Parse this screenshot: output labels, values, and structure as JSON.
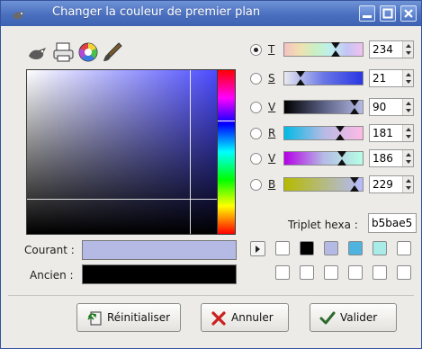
{
  "window": {
    "title": "Changer la couleur de premier plan"
  },
  "titlebar_buttons": {
    "minimize": "minimize-icon",
    "maximize": "maximize-icon",
    "close": "close-icon"
  },
  "tools": [
    {
      "name": "gimp-selector-icon"
    },
    {
      "name": "cmyk-printer-icon"
    },
    {
      "name": "color-wheel-icon"
    },
    {
      "name": "watercolor-brush-icon"
    }
  ],
  "channels": [
    {
      "letter": "T",
      "value": "234",
      "checked": true,
      "fraction": 0.65
    },
    {
      "letter": "S",
      "value": "21",
      "checked": false,
      "fraction": 0.21
    },
    {
      "letter": "V",
      "value": "90",
      "checked": false,
      "fraction": 0.9
    },
    {
      "letter": "R",
      "value": "181",
      "checked": false,
      "fraction": 0.71
    },
    {
      "letter": "V",
      "value": "186",
      "checked": false,
      "fraction": 0.73
    },
    {
      "letter": "B",
      "value": "229",
      "checked": false,
      "fraction": 0.9
    }
  ],
  "hex": {
    "label": "Triplet hexa :",
    "value": "b5bae5"
  },
  "current": {
    "label": "Courant :",
    "color": "#b5bae5"
  },
  "previous": {
    "label": "Ancien :",
    "color": "#000000"
  },
  "history": {
    "row1": [
      "#ffffff",
      "#000000",
      "#b5bae5",
      "#4fb3e0",
      "#a9ebe7",
      "#ffffff"
    ],
    "row2": [
      "#ffffff",
      "#ffffff",
      "#ffffff",
      "#ffffff",
      "#ffffff",
      "#ffffff"
    ]
  },
  "buttons": {
    "reset": "Réinitialiser",
    "cancel": "Annuler",
    "ok": "Valider"
  },
  "colors": {
    "titlebar": "#4a6fbf",
    "dialog_bg": "#ecebe7"
  }
}
